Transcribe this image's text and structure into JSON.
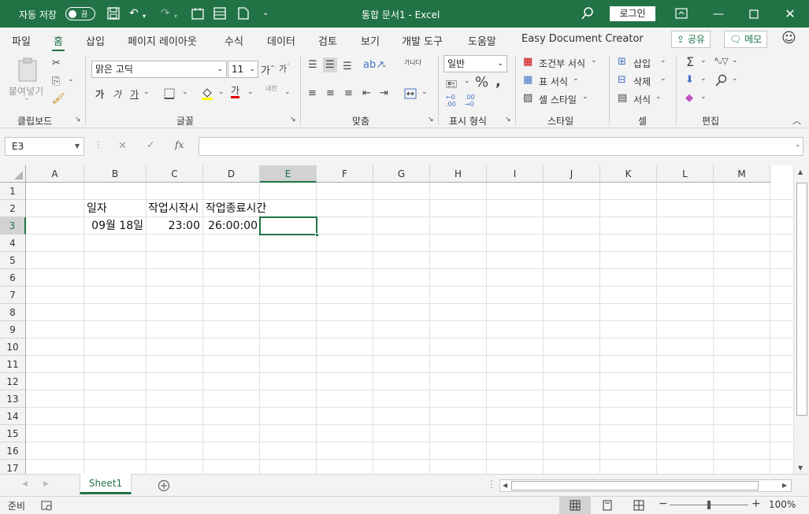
{
  "titlebar": {
    "autosave_label": "자동 저장",
    "autosave_state": "끔",
    "doc_title": "통합 문서1  -  Excel",
    "login_label": "로그인"
  },
  "tabs": [
    "파일",
    "홈",
    "삽입",
    "페이지 레이아웃",
    "수식",
    "데이터",
    "검토",
    "보기",
    "개발 도구",
    "도움말",
    "Easy Document Creator"
  ],
  "active_tab": "홈",
  "share_label": "공유",
  "memo_label": "메모",
  "ribbon": {
    "clipboard": {
      "paste_label": "붙여넣기",
      "group_label": "클립보드"
    },
    "font": {
      "font_name": "맑은 고딕",
      "font_size": "11",
      "bold": "가",
      "italic": "가",
      "underline": "가",
      "group_label": "글꼴",
      "phonetic": "내천"
    },
    "alignment": {
      "group_label": "맞춤",
      "wrap": "가나다"
    },
    "number": {
      "format": "일반",
      "group_label": "표시 형식"
    },
    "styles": {
      "conditional": "조건부 서식",
      "table": "표 서식",
      "cell": "셀 스타일",
      "group_label": "스타일"
    },
    "cells": {
      "insert": "삽입",
      "delete": "삭제",
      "format": "서식",
      "group_label": "셀"
    },
    "editing": {
      "group_label": "편집"
    }
  },
  "formula_bar": {
    "name_box": "E3",
    "fx": "fx",
    "formula": ""
  },
  "columns": [
    "A",
    "B",
    "C",
    "D",
    "E",
    "F",
    "G",
    "H",
    "I",
    "J",
    "K",
    "L",
    "M"
  ],
  "rows": [
    "1",
    "2",
    "3",
    "4",
    "5",
    "6",
    "7",
    "8",
    "9",
    "10",
    "11",
    "12",
    "13",
    "14",
    "15",
    "16",
    "17"
  ],
  "cells": {
    "B2": "일자",
    "C2": "작업시작시",
    "D2": "작업종료시간",
    "B3": "09월 18일",
    "C3": "23:00",
    "D3": "26:00:00"
  },
  "selected_cell": "E3",
  "sheet_tab": "Sheet1",
  "status": {
    "ready": "준비",
    "zoom": "100%"
  }
}
